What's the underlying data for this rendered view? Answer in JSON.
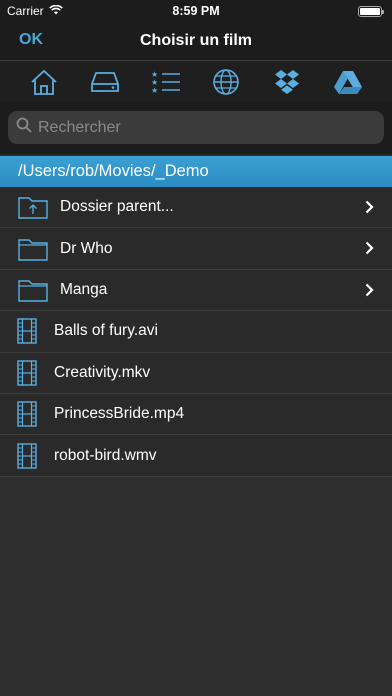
{
  "status": {
    "carrier": "Carrier",
    "time": "8:59 PM"
  },
  "nav": {
    "ok_label": "OK",
    "title": "Choisir un film"
  },
  "sources": [
    {
      "icon": "home-icon"
    },
    {
      "icon": "hard-drive-icon"
    },
    {
      "icon": "star-list-icon"
    },
    {
      "icon": "globe-icon"
    },
    {
      "icon": "dropbox-icon"
    },
    {
      "icon": "google-drive-icon"
    }
  ],
  "search": {
    "placeholder": "Rechercher",
    "value": ""
  },
  "path": "/Users/rob/Movies/_Demo",
  "items": [
    {
      "name": "Dossier parent...",
      "type": "parent"
    },
    {
      "name": "Dr Who",
      "type": "folder"
    },
    {
      "name": "Manga",
      "type": "folder"
    },
    {
      "name": "Balls of fury.avi",
      "type": "video"
    },
    {
      "name": "Creativity.mkv",
      "type": "video"
    },
    {
      "name": "PrincessBride.mp4",
      "type": "video"
    },
    {
      "name": "robot-bird.wmv",
      "type": "video"
    }
  ],
  "colors": {
    "accent": "#4aa8d8",
    "path_bar": "#3aa0d4",
    "icon_blue": "#5aaee0"
  }
}
